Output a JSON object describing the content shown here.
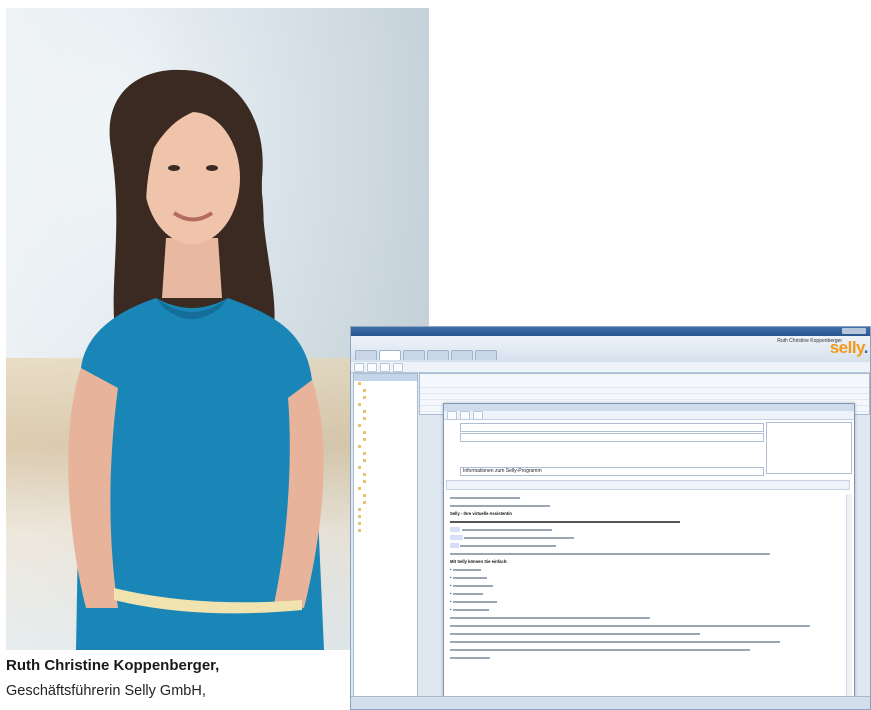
{
  "caption": {
    "name": "Ruth Christine Koppenberger,",
    "role": "Geschäftsführerin Selly GmbH,"
  },
  "app": {
    "user": "Ruth Christine Koppenberger",
    "logo": "selly",
    "compose_subject": "Informationen zum Selly-Programm",
    "body_heading": "Selly - Ihre virtuelle Assistentin",
    "body_section": "Mit Selly können Sie einfach:"
  },
  "colors": {
    "logo_orange": "#f29a1a",
    "logo_blue": "#2a6db5",
    "dress_blue": "#1a86b8"
  }
}
